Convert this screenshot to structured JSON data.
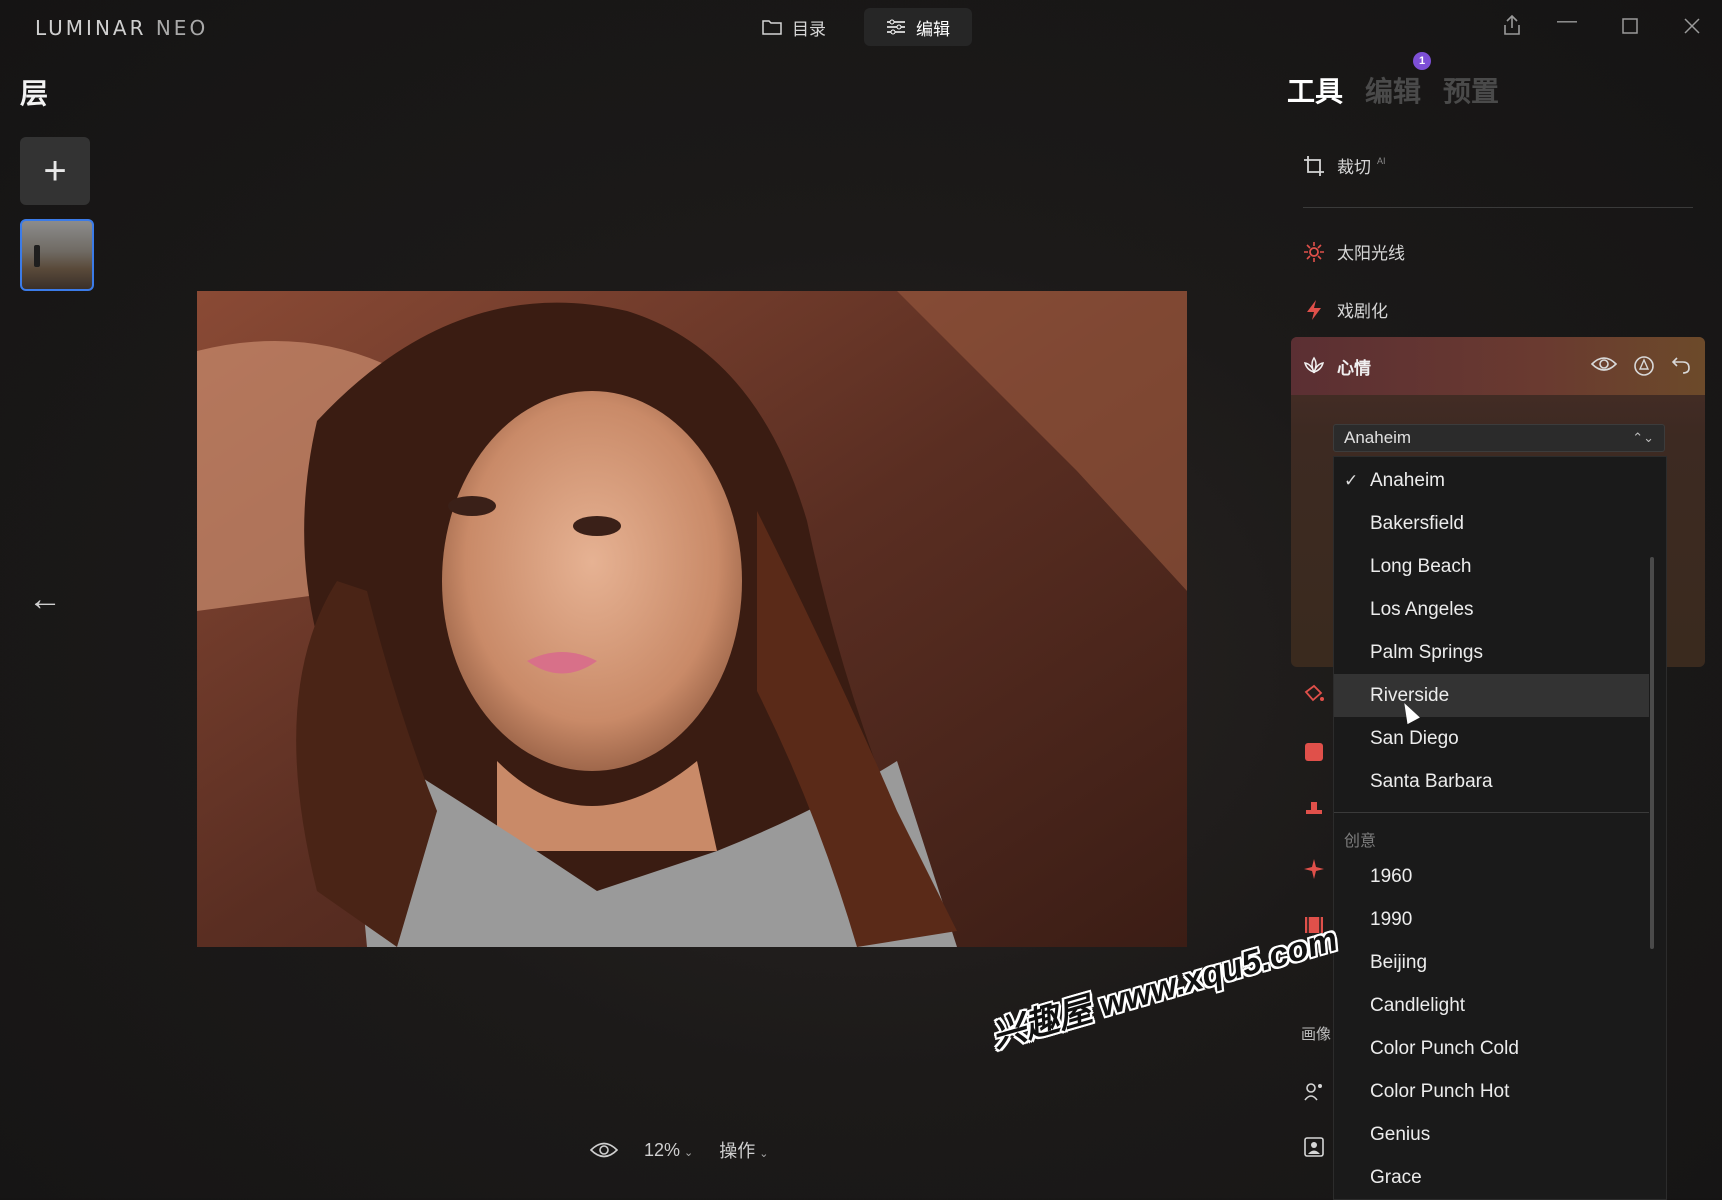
{
  "app": {
    "logo_main": "LUMINAR ",
    "logo_accent": "NEO"
  },
  "top_nav": {
    "catalog_label": "目录",
    "edit_label": "编辑"
  },
  "layers": {
    "title": "层",
    "add_label": "+"
  },
  "canvas": {
    "zoom": "12%",
    "actions_label": "操作"
  },
  "right_tabs": [
    {
      "label": "工具",
      "active": true
    },
    {
      "label": "编辑",
      "active": false,
      "badge": "1"
    },
    {
      "label": "预置",
      "active": false
    }
  ],
  "tools": {
    "crop": {
      "label": "裁切",
      "tag": "AI"
    },
    "sunrays": {
      "label": "太阳光线"
    },
    "dramatic": {
      "label": "戏剧化"
    },
    "mood": {
      "label": "心情"
    }
  },
  "mood_select": {
    "selected": "Anaheim",
    "options": [
      "Anaheim",
      "Bakersfield",
      "Long Beach",
      "Los Angeles",
      "Palm Springs",
      "Riverside",
      "San Diego",
      "Santa Barbara"
    ],
    "hovered": "Riverside",
    "group_label": "创意",
    "creative_options": [
      "1960",
      "1990",
      "Beijing",
      "Candlelight",
      "Color Punch Cold",
      "Color Punch Hot",
      "Genius",
      "Grace"
    ]
  },
  "partial_tool_label": "画像",
  "watermark": "兴趣屋 www.xqu5.com",
  "colors": {
    "accent": "#3b7be8",
    "badge": "#7d4fd6",
    "tool_icon": "#e0504a"
  }
}
